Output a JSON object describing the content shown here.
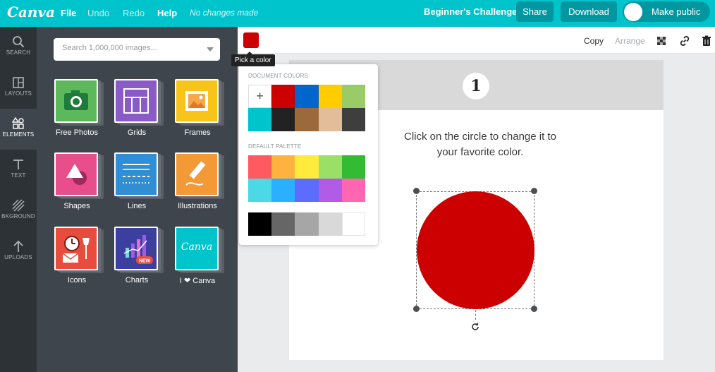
{
  "topbar": {
    "logo": "Canva",
    "menu": {
      "file": "File",
      "undo": "Undo",
      "redo": "Redo",
      "help": "Help"
    },
    "status": "No changes made",
    "design_title": "Beginner's Challenge",
    "share": "Share",
    "download": "Download",
    "make_public": "Make public"
  },
  "rail": {
    "items": [
      {
        "label": "SEARCH",
        "icon": "search-icon"
      },
      {
        "label": "LAYOUTS",
        "icon": "layouts-icon"
      },
      {
        "label": "ELEMENTS",
        "icon": "elements-icon",
        "active": true
      },
      {
        "label": "TEXT",
        "icon": "text-icon"
      },
      {
        "label": "BKGROUND",
        "icon": "background-icon"
      },
      {
        "label": "UPLOADS",
        "icon": "upload-icon"
      }
    ]
  },
  "panel": {
    "search_placeholder": "Search 1,000,000 images...",
    "tiles": [
      {
        "label": "Free Photos",
        "color": "#5db85b",
        "icon": "camera-icon"
      },
      {
        "label": "Grids",
        "color": "#8a5ac7",
        "icon": "grid-icon"
      },
      {
        "label": "Frames",
        "color": "#f8c41a",
        "icon": "frame-icon"
      },
      {
        "label": "Shapes",
        "color": "#e94e8c",
        "icon": "shapes-icon"
      },
      {
        "label": "Lines",
        "color": "#2f8ed4",
        "icon": "lines-icon"
      },
      {
        "label": "Illustrations",
        "color": "#f39a36",
        "icon": "pencil-icon"
      },
      {
        "label": "Icons",
        "color": "#e74c3c",
        "icon": "clock-icon"
      },
      {
        "label": "Charts",
        "color": "#3d3fa0",
        "icon": "chart-icon",
        "badge": "NEW"
      },
      {
        "label": "I ❤ Canva",
        "color": "#00c4cc",
        "icon": "canva-logo-icon",
        "inner": "Canva"
      }
    ]
  },
  "toolbar": {
    "color_swatch": "#cc0000",
    "copy": "Copy",
    "arrange": "Arrange",
    "tooltip": "Pick a color"
  },
  "popover": {
    "document_title": "DOCUMENT COLORS",
    "document_colors": [
      "add",
      "#cc0000",
      "#0066cc",
      "#ffcc00",
      "#99cc66",
      "#00c4cc",
      "#222222",
      "#9c6a3a",
      "#e3bc9a",
      "#3e3e3e"
    ],
    "default_title": "DEFAULT PALETTE",
    "default_colors": [
      "#ff5a5f",
      "#ffb33e",
      "#ffeb3b",
      "#9be066",
      "#33bb33",
      "#4dd8e6",
      "#2ab0ff",
      "#5b6cff",
      "#b15be6",
      "#ff66b2"
    ],
    "gray_colors": [
      "#000000",
      "#666666",
      "#a6a6a6",
      "#d9d9d9",
      "#ffffff"
    ]
  },
  "page": {
    "number": "1",
    "instruction": "Click on the circle to change it to your favorite color.",
    "circle_color": "#cc0000"
  }
}
